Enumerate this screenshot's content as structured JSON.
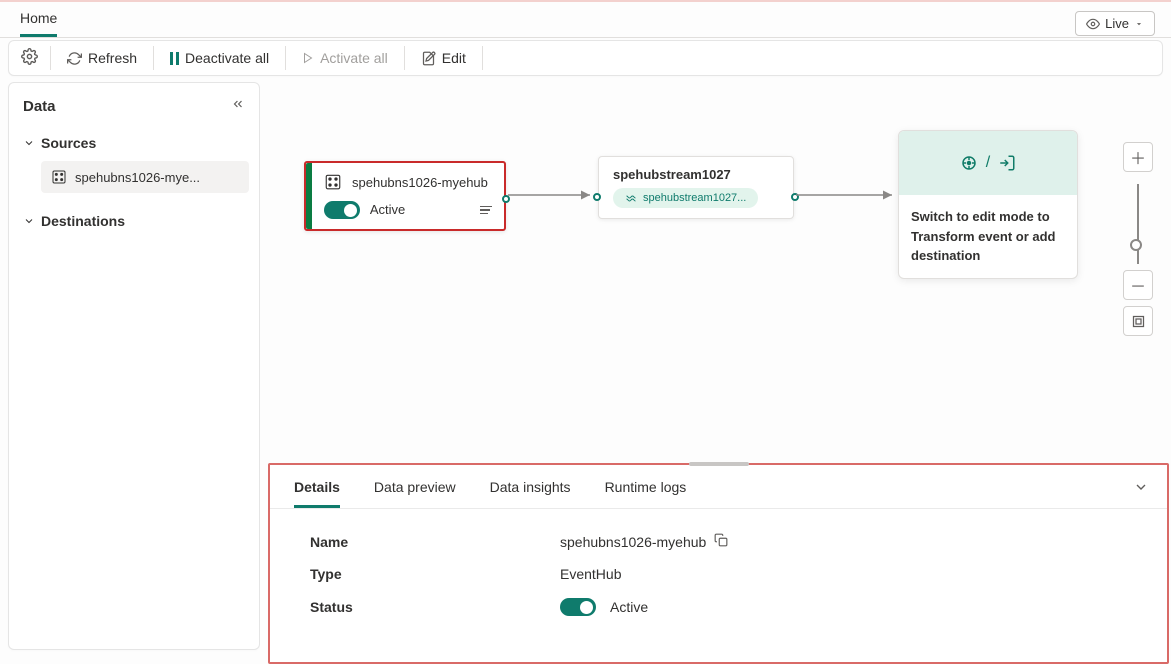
{
  "header": {
    "tab_home": "Home",
    "live_label": "Live"
  },
  "toolbar": {
    "refresh": "Refresh",
    "deactivate_all": "Deactivate all",
    "activate_all": "Activate all",
    "edit": "Edit"
  },
  "sidebar": {
    "title": "Data",
    "sources_label": "Sources",
    "source_item": "spehubns1026-mye...",
    "destinations_label": "Destinations"
  },
  "canvas": {
    "source_node": {
      "title": "spehubns1026-myehub",
      "status": "Active"
    },
    "stream_node": {
      "title": "spehubstream1027",
      "pill": "spehubstream1027..."
    },
    "dest_node": {
      "separator": "/",
      "hint": "Switch to edit mode to Transform event or add destination"
    }
  },
  "details": {
    "tabs": {
      "details": "Details",
      "data_preview": "Data preview",
      "data_insights": "Data insights",
      "runtime_logs": "Runtime logs"
    },
    "rows": {
      "name_label": "Name",
      "name_value": "spehubns1026-myehub",
      "type_label": "Type",
      "type_value": "EventHub",
      "status_label": "Status",
      "status_value": "Active"
    }
  }
}
